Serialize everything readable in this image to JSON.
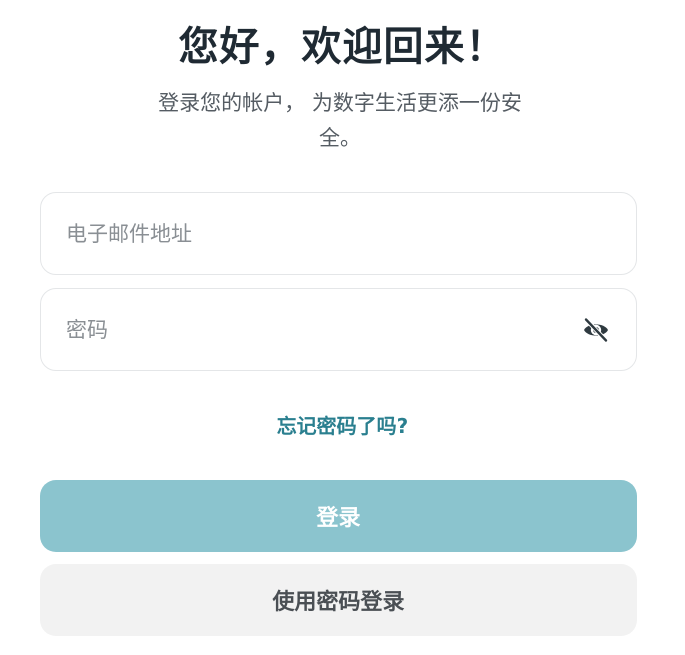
{
  "header": {
    "title": "您好，欢迎回来！",
    "subtitle": "登录您的帐户， 为数字生活更添一份安全。"
  },
  "form": {
    "email_placeholder": "电子邮件地址",
    "password_placeholder": "密码",
    "password_toggle_icon": "eye-off-icon",
    "forgot_label": "忘记密码了吗?",
    "login_label": "登录",
    "password_login_label": "使用密码登录"
  },
  "colors": {
    "accent": "#2a7f8f",
    "login_button": "#8bc4ce",
    "secondary_button": "#f2f2f2",
    "title": "#1f2a33"
  }
}
